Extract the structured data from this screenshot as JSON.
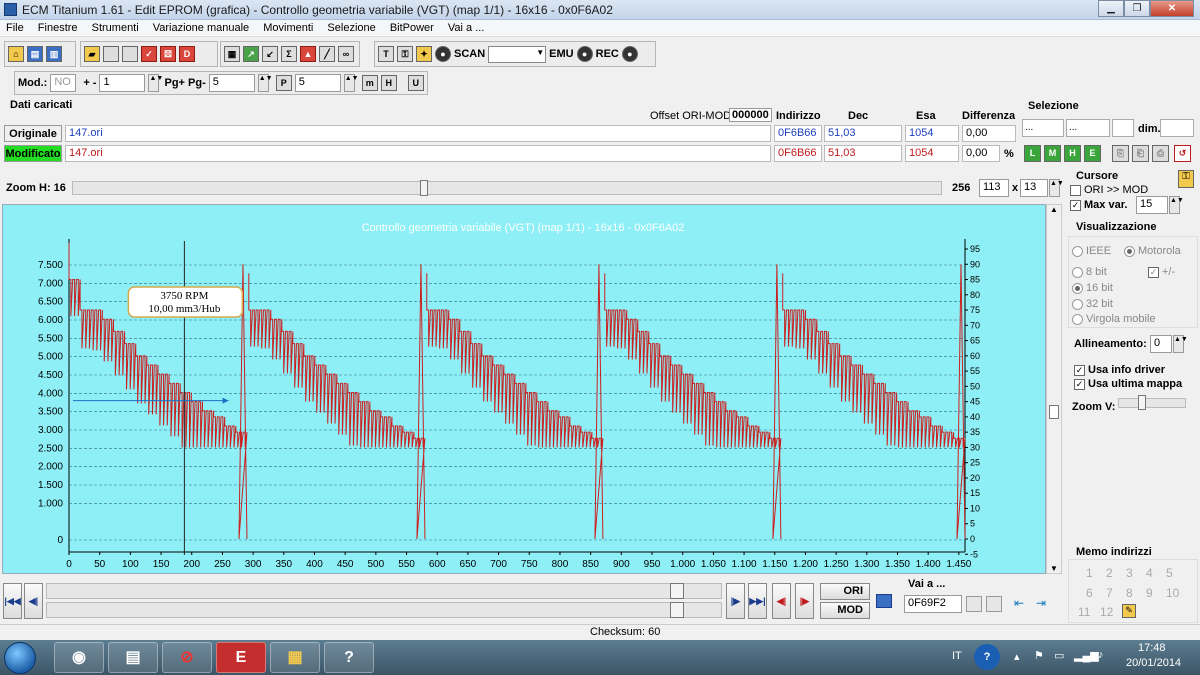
{
  "window": {
    "title": "ECM Titanium 1.61 - Edit EPROM (grafica) - Controllo geometria variabile (VGT) (map 1/1) - 16x16 - 0x0F6A02"
  },
  "menu": [
    "File",
    "Finestre",
    "Strumenti",
    "Variazione manuale",
    "Movimenti",
    "Selezione",
    "BitPower",
    "Vai a ..."
  ],
  "toolbar": {
    "scan": "SCAN",
    "emu": "EMU",
    "rec": "REC"
  },
  "toolbar2": {
    "mod_label": "Mod.:",
    "mod_value": "NO",
    "plusminus_label": "+ -",
    "plusminus_value": "1",
    "pg_label": "Pg+ Pg-",
    "pg_value": "5",
    "p_icon": "P",
    "p_value": "5",
    "m_icon": "m",
    "h_icon": "H",
    "u_icon": "U"
  },
  "dati": {
    "header": "Dati caricati",
    "offset_label": "Offset ORI-MOD",
    "offset_value": "000000",
    "col_indirizzo": "Indirizzo",
    "col_dec": "Dec",
    "col_esa": "Esa",
    "col_diff": "Differenza",
    "originale": {
      "label": "Originale",
      "file": "147.ori",
      "indirizzo": "0F6B66",
      "dec": "51,03",
      "esa": "1054",
      "diff": "0,00"
    },
    "modificato": {
      "label": "Modificato",
      "file": "147.ori",
      "indirizzo": "0F6B66",
      "dec": "51,03",
      "esa": "1054",
      "diff": "0,00",
      "unit": "%"
    }
  },
  "selezione": {
    "title": "Selezione",
    "f1": "...",
    "f2": "...",
    "dim_label": "dim."
  },
  "zoom": {
    "label": "Zoom H: 16",
    "max": "256",
    "val1": "113",
    "x": "x",
    "val2": "13"
  },
  "cursore": {
    "title": "Cursore",
    "ori_mod": "ORI >> MOD",
    "max_var": "Max var.",
    "max_var_value": "15"
  },
  "visualizzazione": {
    "title": "Visualizzazione",
    "ieee": "IEEE",
    "motorola": "Motorola",
    "bit8": "8 bit",
    "plusminus": "+/-",
    "bit16": "16 bit",
    "bit32": "32 bit",
    "virgola": "Virgola mobile",
    "allineamento": "Allineamento:",
    "allineamento_value": "0",
    "usa_info": "Usa info driver",
    "usa_ultima": "Usa ultima mappa",
    "zoomv": "Zoom V:"
  },
  "memo": {
    "title": "Memo indirizzi",
    "numbers": [
      "1",
      "2",
      "3",
      "4",
      "5",
      "6",
      "7",
      "8",
      "9",
      "10",
      "11",
      "12"
    ]
  },
  "nav": {
    "ori": "ORI",
    "mod": "MOD",
    "vai_a": "Vai a ...",
    "vai_value": "0F69F2"
  },
  "status": {
    "checksum": "Checksum: 60"
  },
  "taskbar": {
    "lang": "IT",
    "time": "17:48",
    "date": "20/01/2014"
  },
  "chart_data": {
    "type": "line",
    "title": "Controllo geometria variabile (VGT) (map 1/1) - 16x16 - 0x0F6A02",
    "xlim": [
      0,
      1460
    ],
    "xticks": [
      0,
      50,
      100,
      150,
      200,
      250,
      300,
      350,
      400,
      450,
      500,
      550,
      600,
      650,
      700,
      750,
      800,
      850,
      900,
      950,
      1000,
      1050,
      1100,
      1150,
      1200,
      1250,
      1300,
      1350,
      1400,
      1450
    ],
    "ylim_left": [
      0,
      7500
    ],
    "yticks_left": [
      "0",
      "1.000",
      "1.500",
      "2.000",
      "2.500",
      "3.000",
      "3.500",
      "4.000",
      "4.500",
      "5.000",
      "5.500",
      "6.000",
      "6.500",
      "7.000",
      "7.500"
    ],
    "ytick_left_values": [
      0,
      1000,
      1500,
      2000,
      2500,
      3000,
      3500,
      4000,
      4500,
      5000,
      5500,
      6000,
      6500,
      7000,
      7500
    ],
    "ylim_right": [
      -5,
      95
    ],
    "yticks_right": [
      -5,
      0,
      5,
      10,
      15,
      20,
      25,
      30,
      35,
      40,
      45,
      50,
      55,
      60,
      65,
      70,
      75,
      80,
      85,
      90,
      95
    ],
    "grid": true,
    "cursor_x": 188,
    "tooltip": {
      "rpm": "3750 RPM",
      "load": "10,00 mm3/Hub"
    },
    "line_color": "#cc1f1f",
    "background": "#8ef0f6",
    "segments": [
      {
        "x_start": 0,
        "x_end": 290,
        "right_values": [
          85,
          75,
          75,
          72,
          68,
          64,
          60,
          57,
          54,
          51,
          48,
          45,
          42,
          40,
          37,
          35
        ]
      },
      {
        "x_start": 293,
        "x_end": 580,
        "right_values": [
          75,
          75,
          72,
          68,
          64,
          60,
          57,
          54,
          51,
          48,
          45,
          42,
          40,
          37,
          35,
          33
        ]
      },
      {
        "x_start": 583,
        "x_end": 870,
        "right_values": [
          75,
          75,
          72,
          68,
          64,
          60,
          57,
          54,
          51,
          48,
          45,
          42,
          40,
          37,
          35,
          33
        ]
      },
      {
        "x_start": 873,
        "x_end": 1160,
        "right_values": [
          75,
          75,
          72,
          68,
          64,
          60,
          57,
          54,
          51,
          48,
          45,
          42,
          40,
          37,
          35,
          33
        ]
      },
      {
        "x_start": 1163,
        "x_end": 1460,
        "right_values": [
          75,
          75,
          72,
          68,
          64,
          60,
          57,
          54,
          51,
          48,
          45,
          42,
          40,
          37,
          35,
          33
        ]
      }
    ]
  }
}
